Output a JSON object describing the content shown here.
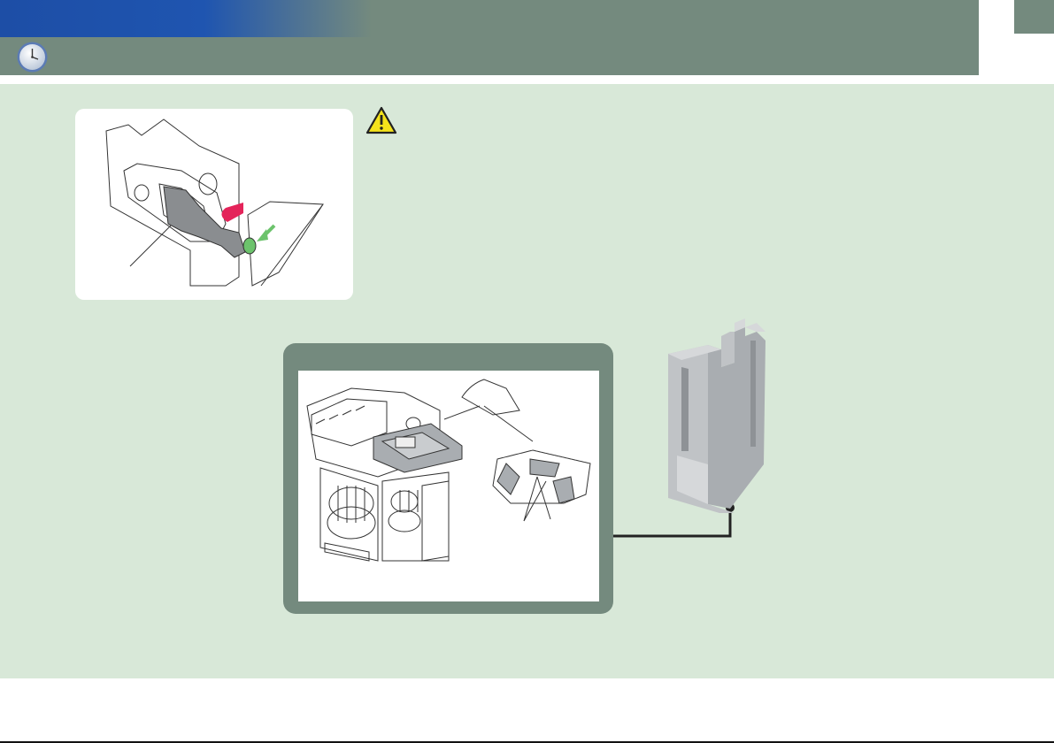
{
  "colors": {
    "header": "#748a7e",
    "header_blue": "#1d4ea6",
    "content_background": "#d8e8d8",
    "warning": "#f4e21b",
    "lever": "#8a8d90",
    "pink_marker": "#e4245a",
    "green_marker": "#6cc36c",
    "part_gray": "#a9adb1"
  },
  "icons": {
    "header": "clock-icon",
    "notice": "warning-icon"
  }
}
